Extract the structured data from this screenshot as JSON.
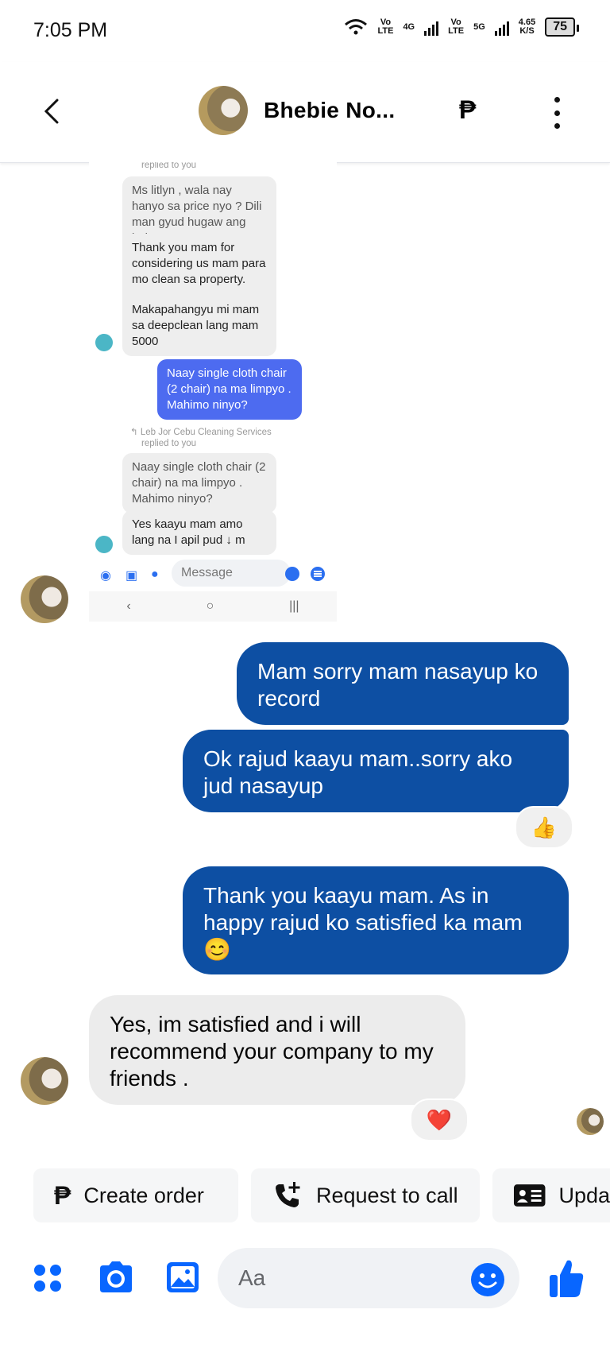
{
  "status_bar": {
    "time": "7:05 PM",
    "sim1_top": "Vo",
    "sim1_bottom": "LTE",
    "net1": "4G",
    "sim2_top": "Vo",
    "sim2_bottom": "LTE",
    "net2": "5G",
    "speed_value": "4.65",
    "speed_unit": "K/S",
    "battery": "75"
  },
  "header": {
    "contact_name": "Bhebie No...",
    "peso_icon": "₱"
  },
  "embedded_screenshot": {
    "replied_top": "replied to you",
    "quoted_1": "Ms litlyn , wala nay hanyo sa price nyo ? Dili man gyud hugaw ang balay  n...",
    "reply_1": "Thank you mam for considering us mam para mo clean sa property.",
    "reply_1b": "Makapahangyu mi mam sa deepclean lang mam 5000",
    "my_message": "Naay single cloth chair  (2 chair) na ma limpyo . Mahimo ninyo?",
    "replied_by": "↰ Leb Jor Cebu Cleaning Services",
    "replied_to": "replied to you",
    "quoted_2": "Naay single cloth chair  (2 chair) na ma limpyo . Mahimo ninyo?",
    "reply_2": "Yes kaayu mam amo lang na I apil pud  ↓ m",
    "message_placeholder": "Message"
  },
  "messages": [
    {
      "from": "me",
      "text": "Mam sorry mam nasayup ko record"
    },
    {
      "from": "me",
      "text": "Ok rajud kaayu mam..sorry ako jud nasayup",
      "reaction": "👍"
    },
    {
      "from": "me",
      "text": "Thank you kaayu mam. As in happy rajud ko satisfied ka mam 😊"
    },
    {
      "from": "them",
      "text": "Yes, im satisfied and  i will recommend your company to my friends .",
      "reaction": "❤️"
    }
  ],
  "quick_actions": [
    {
      "label": "Create order",
      "icon": "peso-icon"
    },
    {
      "label": "Request to call",
      "icon": "phone-plus-icon"
    },
    {
      "label": "Upda",
      "icon": "contact-card-icon"
    }
  ],
  "composer": {
    "placeholder": "Aa"
  },
  "colors": {
    "outgoing_bubble": "#0d4fa3",
    "incoming_bubble": "#ececec",
    "accent": "#0866ff"
  }
}
